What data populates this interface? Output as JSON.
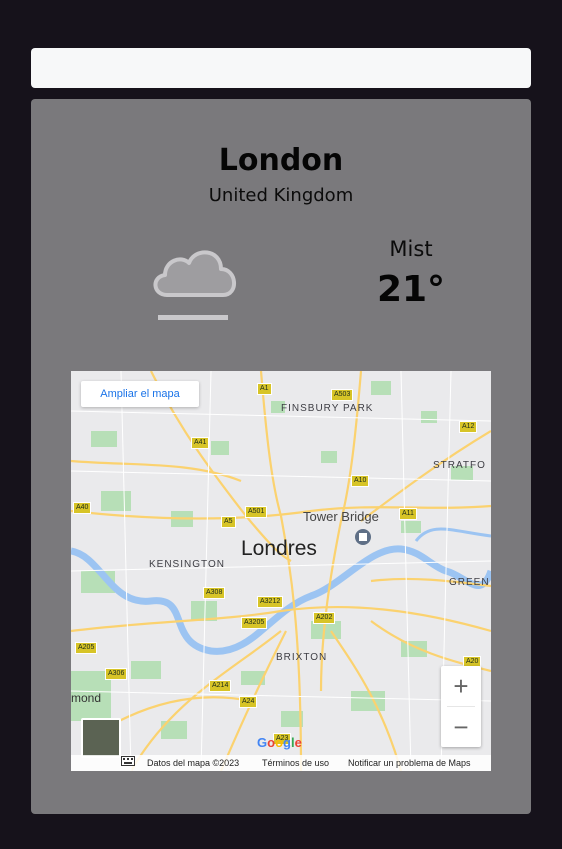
{
  "search": {
    "value": "",
    "placeholder": ""
  },
  "weather": {
    "city": "London",
    "country": "United Kingdom",
    "condition": "Mist",
    "temperature": "21°",
    "icon": "mist-cloud-icon"
  },
  "map": {
    "enlarge_label": "Ampliar el mapa",
    "city_label": "Londres",
    "poi_label": "Tower Bridge",
    "districts": [
      "FINSBURY PARK",
      "KENSINGTON",
      "BRIXTON",
      "STRATFO",
      "GREEN"
    ],
    "roads": [
      "A1",
      "A503",
      "A41",
      "A12",
      "A10",
      "A40",
      "A5",
      "A501",
      "A11",
      "A308",
      "A3212",
      "A202",
      "A3205",
      "A205",
      "A306",
      "A214",
      "A24",
      "A20",
      "A23"
    ],
    "zoom_in": "+",
    "zoom_out": "−",
    "google": "Google",
    "attribution": [
      "Datos del mapa ©2023",
      "Términos de uso",
      "Notificar un problema de Maps"
    ],
    "bottom_left_text": "mond"
  }
}
